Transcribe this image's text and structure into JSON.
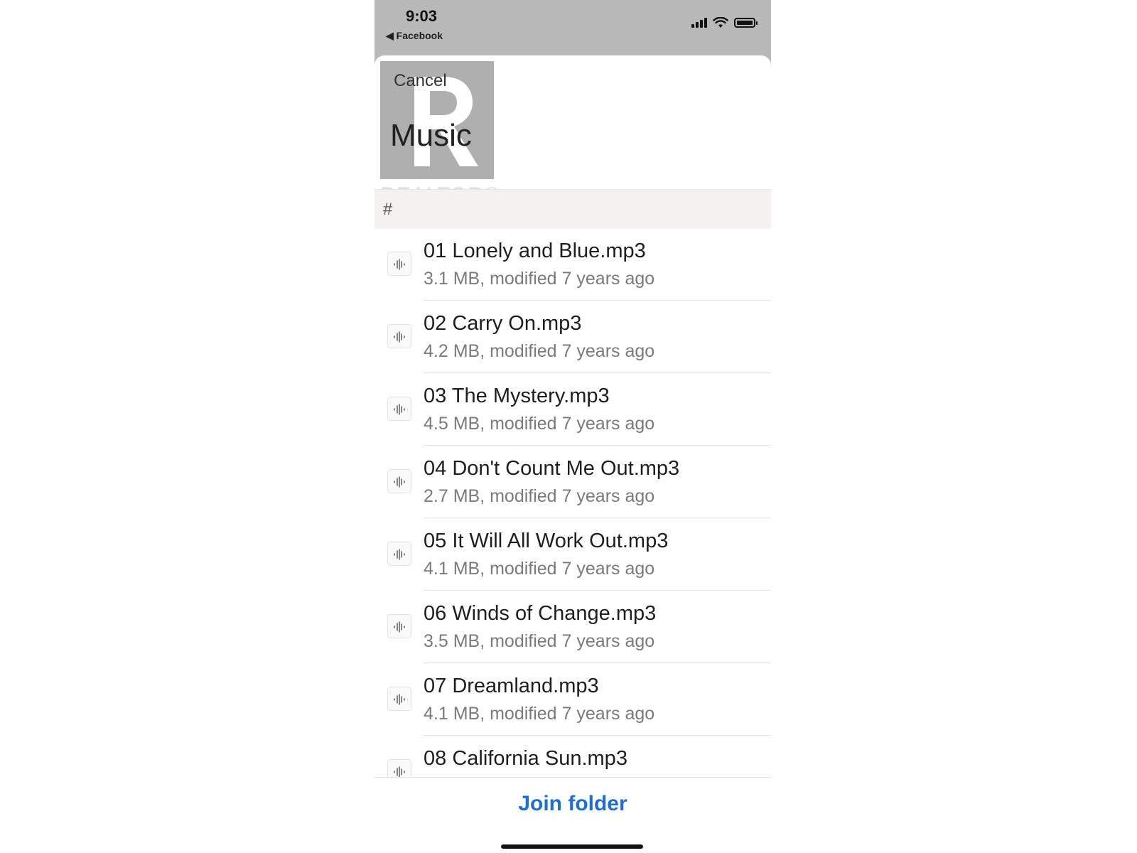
{
  "status_bar": {
    "time": "9:03",
    "back_label": "Facebook",
    "icons": [
      "cellular-signal-icon",
      "wifi-icon",
      "battery-icon"
    ]
  },
  "watermark": {
    "text": "REALTOR",
    "icon": "realtor-r-logo"
  },
  "sheet": {
    "cancel_label": "Cancel",
    "title": "Music",
    "section_header": "#"
  },
  "files": [
    {
      "name": "01 Lonely and Blue.mp3",
      "meta": "3.1 MB, modified 7 years ago"
    },
    {
      "name": "02 Carry On.mp3",
      "meta": "4.2 MB, modified 7 years ago"
    },
    {
      "name": "03 The Mystery.mp3",
      "meta": "4.5 MB, modified 7 years ago"
    },
    {
      "name": "04 Don't Count Me Out.mp3",
      "meta": "2.7 MB, modified 7 years ago"
    },
    {
      "name": "05 It Will All Work Out.mp3",
      "meta": "4.1 MB, modified 7 years ago"
    },
    {
      "name": "06 Winds of Change.mp3",
      "meta": "3.5 MB, modified 7 years ago"
    },
    {
      "name": "07 Dreamland.mp3",
      "meta": "4.1 MB, modified 7 years ago"
    },
    {
      "name": "08 California Sun.mp3",
      "meta": ""
    }
  ],
  "footer": {
    "join_label": "Join folder"
  },
  "colors": {
    "accent": "#1f6ed4",
    "status_bar_bg": "#b9b9b9",
    "section_header_bg": "#f3f2f0",
    "secondary_text": "#7a7a7a"
  }
}
